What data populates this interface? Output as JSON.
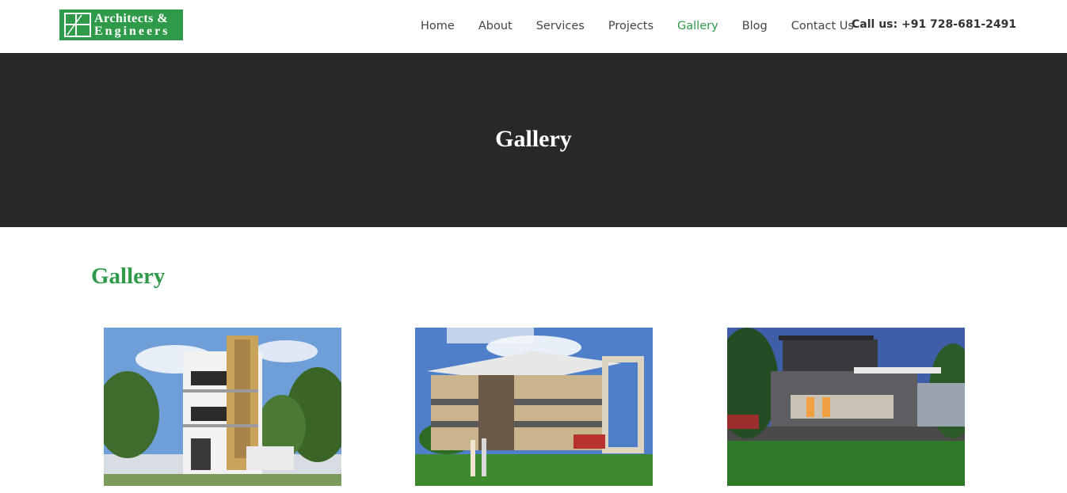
{
  "brand": {
    "line1": "Architects &",
    "line2": "Engineers",
    "color": "#2e9a4a"
  },
  "nav": {
    "items": [
      {
        "label": "Home",
        "active": false
      },
      {
        "label": "About",
        "active": false
      },
      {
        "label": "Services",
        "active": false
      },
      {
        "label": "Projects",
        "active": false
      },
      {
        "label": "Gallery",
        "active": true
      },
      {
        "label": "Blog",
        "active": false
      },
      {
        "label": "Contact Us",
        "active": false
      }
    ],
    "call_label": "Call us:",
    "call_number": "+91 728-681-2491"
  },
  "banner": {
    "title": "Gallery"
  },
  "gallery": {
    "heading": "Gallery",
    "images": [
      {
        "name": "three-storey-residence-render",
        "caption": ""
      },
      {
        "name": "villa-with-pergola-render",
        "caption": ""
      },
      {
        "name": "modern-house-night-render",
        "caption": ""
      }
    ]
  },
  "colors": {
    "accent": "#2e9a4a",
    "banner_bg": "#282828"
  }
}
